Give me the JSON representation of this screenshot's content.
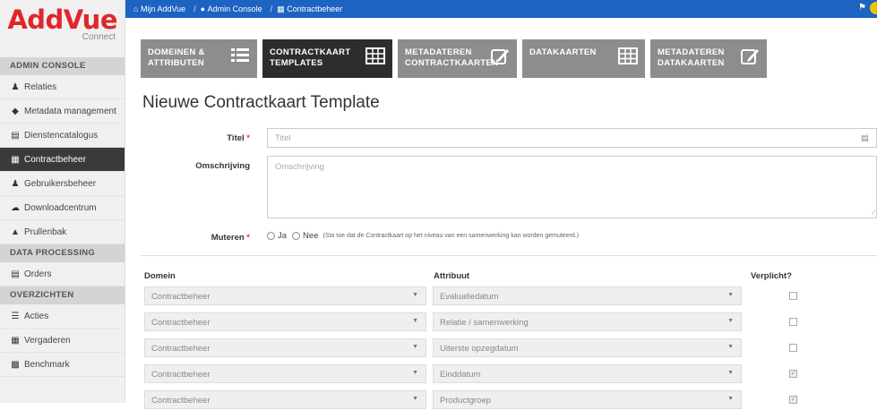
{
  "brand": {
    "name": "AddVue",
    "sub": "Connect"
  },
  "sidebar": {
    "sections": [
      {
        "title": "ADMIN CONSOLE",
        "items": [
          {
            "label": "Relaties",
            "icon": "users-icon"
          },
          {
            "label": "Metadata management",
            "icon": "tag-icon"
          },
          {
            "label": "Dienstencatalogus",
            "icon": "book-icon"
          },
          {
            "label": "Contractbeheer",
            "icon": "table-icon",
            "active": true
          },
          {
            "label": "Gebruikersbeheer",
            "icon": "group-icon"
          },
          {
            "label": "Downloadcentrum",
            "icon": "cloud-download-icon"
          },
          {
            "label": "Prullenbak",
            "icon": "trash-icon"
          }
        ]
      },
      {
        "title": "DATA PROCESSING",
        "items": [
          {
            "label": "Orders",
            "icon": "document-icon"
          }
        ]
      },
      {
        "title": "OVERZICHTEN",
        "items": [
          {
            "label": "Acties",
            "icon": "list-icon"
          },
          {
            "label": "Vergaderen",
            "icon": "calendar-icon"
          },
          {
            "label": "Benchmark",
            "icon": "chart-icon"
          }
        ]
      }
    ]
  },
  "breadcrumb": {
    "home": "Mijn AddVue",
    "admin": "Admin Console",
    "current": "Contractbeheer"
  },
  "tiles": [
    {
      "line1": "DOMEINEN &",
      "line2": "ATTRIBUTEN",
      "icon": "list-icon"
    },
    {
      "line1": "CONTRACTKAART",
      "line2": "TEMPLATES",
      "icon": "table-icon",
      "active": true
    },
    {
      "line1": "METADATEREN",
      "line2": "CONTRACTKAARTEN",
      "icon": "edit-icon"
    },
    {
      "line1": "DATAKAARTEN",
      "line2": "",
      "icon": "table-icon"
    },
    {
      "line1": "METADATEREN",
      "line2": "DATAKAARTEN",
      "icon": "edit-icon"
    }
  ],
  "page_title": "Nieuwe Contractkaart Template",
  "form": {
    "titel_label": "Titel",
    "titel_placeholder": "Titel",
    "omschrijving_label": "Omschrijving",
    "omschrijving_placeholder": "Omschrijving",
    "muteren_label": "Muteren",
    "ja": "Ja",
    "nee": "Nee",
    "hint": "(Sta toe dat de Contractkaart op het niveau van een samenwerking kan worden gemuteerd.)"
  },
  "table": {
    "headers": {
      "domein": "Domein",
      "attribuut": "Attribuut",
      "verplicht": "Verplicht?"
    },
    "rows": [
      {
        "domein": "Contractbeheer",
        "attribuut": "Evaluatiedatum",
        "verplicht": false
      },
      {
        "domein": "Contractbeheer",
        "attribuut": "Relatie / samenwerking",
        "verplicht": false
      },
      {
        "domein": "Contractbeheer",
        "attribuut": "Uiterste opzegdatum",
        "verplicht": false
      },
      {
        "domein": "Contractbeheer",
        "attribuut": "Einddatum",
        "verplicht": true
      },
      {
        "domein": "Contractbeheer",
        "attribuut": "Productgroep",
        "verplicht": true
      }
    ]
  },
  "colors": {
    "brand_red": "#e0262a",
    "topbar_blue": "#1d63c2",
    "tile_grey": "#8d8d8d",
    "tile_active": "#2d2d2d"
  }
}
